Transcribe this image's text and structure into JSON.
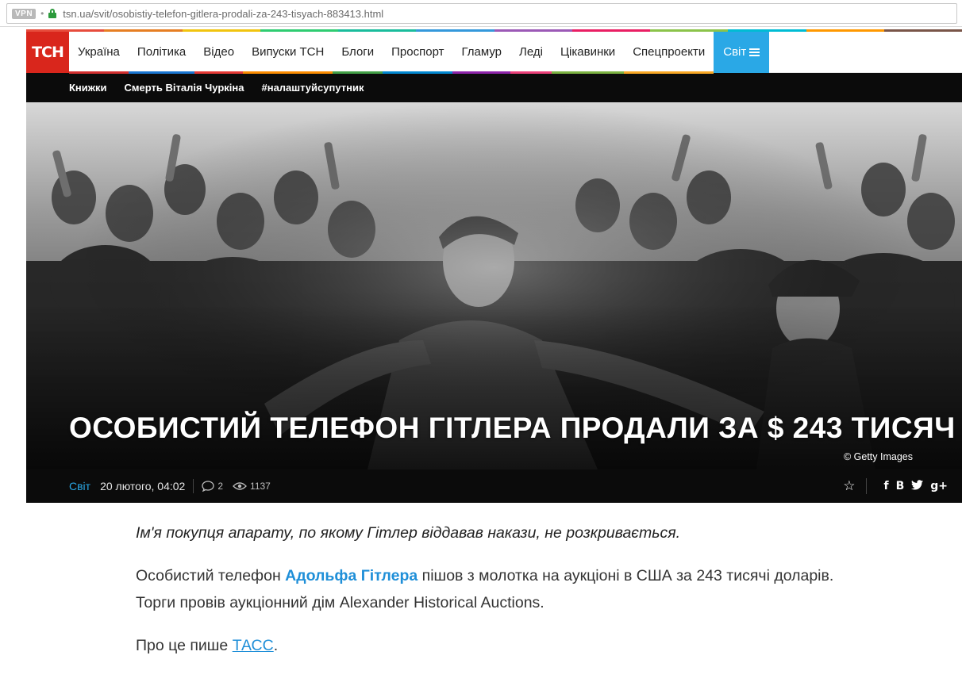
{
  "browser": {
    "vpn_label": "VPN",
    "url": "tsn.ua/svit/osobistiy-telefon-gitlera-prodali-za-243-tisyach-883413.html"
  },
  "site": {
    "logo": "ТСН",
    "strip_colors": [
      "#e74c3c",
      "#e67e22",
      "#f1c40f",
      "#2ecc71",
      "#1abc9c",
      "#3498db",
      "#9b59b6",
      "#e91e63",
      "#8bc34a",
      "#00bcd4",
      "#ff9800",
      "#795548"
    ],
    "nav": [
      {
        "label": "Україна",
        "color": "#d32f2f"
      },
      {
        "label": "Політика",
        "color": "#1976d2"
      },
      {
        "label": "Відео",
        "color": "#e53935"
      },
      {
        "label": "Випуски ТСН",
        "color": "#fb8c00"
      },
      {
        "label": "Блоги",
        "color": "#43a047"
      },
      {
        "label": "Проспорт",
        "color": "#0288d1"
      },
      {
        "label": "Гламур",
        "color": "#8e24aa"
      },
      {
        "label": "Леді",
        "color": "#ec407a"
      },
      {
        "label": "Цікавинки",
        "color": "#7cb342"
      },
      {
        "label": "Спецпроекти",
        "color": "#f9a825"
      }
    ],
    "nav_active": "Світ",
    "accent": "#2aa8e6",
    "subnav": [
      "Книжки",
      "Смерть Віталія Чуркіна",
      "#налаштуйсупутник"
    ]
  },
  "hero": {
    "title": "ОСОБИСТИЙ ТЕЛЕФОН ГІТЛЕРА ПРОДАЛИ ЗА $ 243 ТИСЯЧ",
    "credit": "© Getty Images"
  },
  "meta": {
    "category": "Світ",
    "date": "20 лютого, 04:02",
    "comments": "2",
    "views": "1137",
    "share": [
      "f",
      "B",
      "t",
      "g+"
    ]
  },
  "article": {
    "lead": "Ім'я покупця апарату, по якому Гітлер віддавав накази, не розкривається.",
    "p1_before": "Особистий телефон ",
    "p1_link": "Адольфа Гітлера",
    "p1_after": " пішов з молотка на аукціоні в США за 243 тисячі доларів. Торги провів аукціонний дім Alexander Historical Auctions.",
    "p2_before": "Про це пише ",
    "p2_link": "ТАСС",
    "p2_after": "."
  }
}
